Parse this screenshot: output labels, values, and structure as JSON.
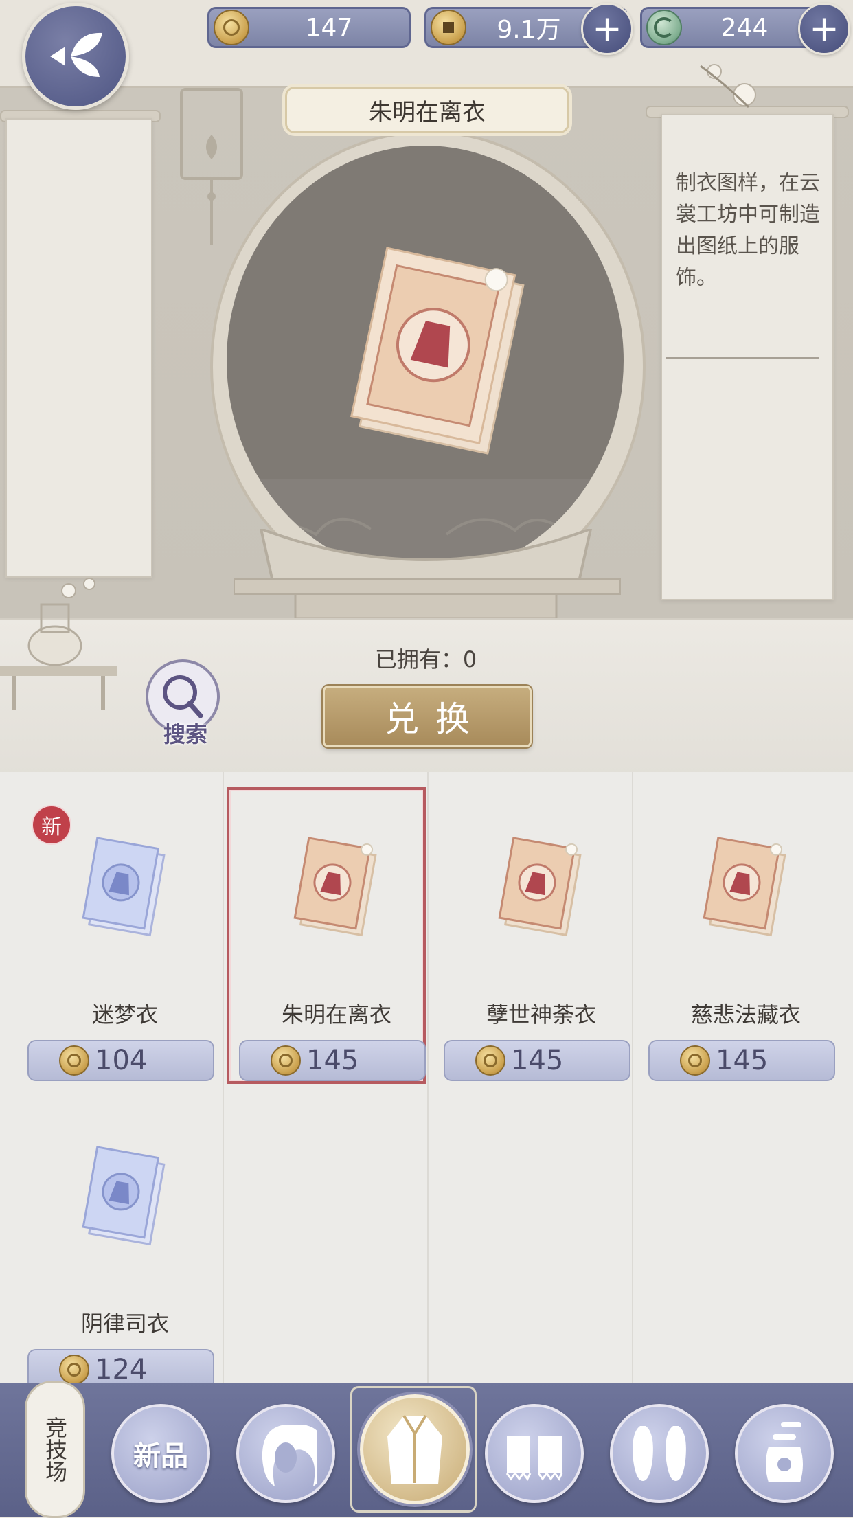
{
  "top_bar": {
    "currencies": [
      {
        "icon": "gold-coin-icon",
        "value": "147",
        "has_plus": false
      },
      {
        "icon": "copper-coin-icon",
        "value": "9.1万",
        "has_plus": true
      },
      {
        "icon": "jade-dragon-icon",
        "value": "244",
        "has_plus": true
      }
    ],
    "plus_symbol": "+"
  },
  "display": {
    "item_title": "朱明在离衣",
    "description": "制衣图样，在云裳工坊中可制造出图纸上的服饰。",
    "owned_label": "已拥有：0",
    "redeem_label": "兑换",
    "search_label": "搜索"
  },
  "grid": {
    "new_badge": "新",
    "items": [
      {
        "name": "迷梦衣",
        "price": "104",
        "variant": "blue",
        "is_new": true,
        "selected": false
      },
      {
        "name": "朱明在离衣",
        "price": "145",
        "variant": "peach",
        "is_new": false,
        "selected": true
      },
      {
        "name": "孽世神荼衣",
        "price": "145",
        "variant": "peach",
        "is_new": false,
        "selected": false
      },
      {
        "name": "慈悲法藏衣",
        "price": "145",
        "variant": "peach",
        "is_new": false,
        "selected": false
      },
      {
        "name": "阴律司衣",
        "price": "124",
        "variant": "blue",
        "is_new": false,
        "selected": false
      }
    ]
  },
  "bottom_nav": {
    "arena_label": "竞技场",
    "new_label": "新品",
    "tabs": [
      "hair-icon",
      "top-icon",
      "bottom-icon",
      "shoes-icon",
      "accessory-icon"
    ]
  },
  "colors": {
    "accent": "#5b6188",
    "gold": "#b69a69",
    "selected": "#b65a5f"
  }
}
